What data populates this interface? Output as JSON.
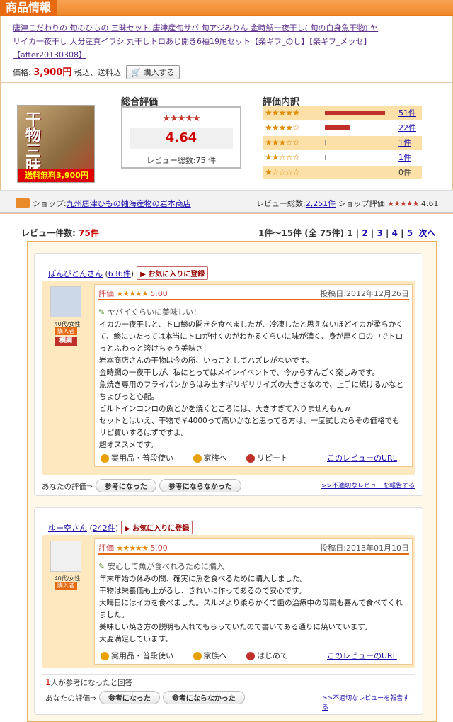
{
  "header": {
    "title": "商品情報"
  },
  "product": {
    "title": "唐津こだわりの 旬のひもの 三昧セット 唐津産旬サバ 旬アジみりん 金時鯛一夜干し( 旬の白身魚干物) ヤリイカ一夜干し 大分産真イワシ 丸干しトロあじ開き6種19尾セット【楽ギフ_のし】【楽ギフ_メッセ】【after20130308】",
    "price_label": "価格:",
    "price": "3,900円",
    "price_note": "税込、送料込",
    "buy_label": "購入する",
    "thumb_text": "干物三昧",
    "thumb_sub": "送料無料3,900円"
  },
  "overall": {
    "title": "総合評価",
    "stars": "★★★★★",
    "score": "4.64",
    "count_text": "レビュー総数:75 件"
  },
  "breakdown": {
    "title": "評価内訳",
    "rows": [
      {
        "stars": "★★★★★",
        "count": "51件",
        "fraction": 0.68,
        "link": true
      },
      {
        "stars": "★★★★☆",
        "count": "22件",
        "fraction": 0.29,
        "link": true
      },
      {
        "stars": "★★★☆☆",
        "count": "1件",
        "fraction": 0.013,
        "link": true
      },
      {
        "stars": "★★☆☆☆",
        "count": "1件",
        "fraction": 0.013,
        "link": true
      },
      {
        "stars": "★☆☆☆☆",
        "count": "0件",
        "fraction": 0,
        "link": false
      }
    ]
  },
  "shop": {
    "label": "ショップ:",
    "name": "九州唐津ひもの軸海産物の岩本商店",
    "review_label": "レビュー総数:",
    "review_count": "2,251件",
    "rating_label": "ショップ評価",
    "stars": "★★★★★",
    "rating": "4.61"
  },
  "list": {
    "count_label": "レビュー件数:",
    "count": "75件",
    "range": "1件〜15件 (全 75件)",
    "pages": [
      "1",
      "2",
      "3",
      "4",
      "5"
    ],
    "next": "次へ>>"
  },
  "reviews": [
    {
      "user": "ぽんぴとんさん",
      "posts": "636件",
      "fav": "▶ お気に入りに登録",
      "age": "40代/女性",
      "badge": "購入者",
      "badge2": "横綱",
      "rating_label": "評価",
      "stars": "★★★★★",
      "score": "5.00",
      "date": "投稿日:2012年12月26日",
      "title": "ヤバイくらいに美味しい！",
      "body": "イカの一夜干しと、トロ鯵の開きを食べましたが、冷凍したと思えないほどイカが柔らかくて、鯵にいたっては本当にトロが付くのがわかるくらいに味が濃く、身が厚く口の中でトロっとふわっと溶けちゃう美味さ！\n岩本商店さんの干物は今の所、いっことしてハズレがないです。\n金時鯛の一夜干しが、私にとってはメインイベントで、今からすんごく楽しみです。\n魚焼き専用のフライパンからはみ出すギリギリサイズの大きさなので、上手に焼けるかなとちょびっと心配。\nビルトインコンロの魚とかを焼くところには、大きすぎて入りませんもんw\nセットとはいえ、干物で￥4000って高いかなと思ってる方は、一度試したらその価格でもリピ買いするはずですよ。\n超オススメです。",
      "tags": [
        "実用品・普段使い",
        "家族へ",
        "リピート"
      ],
      "url_label": "このレビューのURL",
      "helpful": "",
      "your_rating": "あなたの評価⇒",
      "yes": "参考になった",
      "no": "参考にならなかった",
      "report": ">>不適切なレビューを報告する"
    },
    {
      "user": "ゆー空さん",
      "posts": "242件",
      "fav": "▶ お気に入りに登録",
      "age": "40代/女性",
      "badge": "購入者",
      "badge2": "",
      "rating_label": "評価",
      "stars": "★★★★★",
      "score": "5.00",
      "date": "投稿日:2013年01月10日",
      "title": "安心して魚が食べれるために購入",
      "body": "年末年始の休みの間、確実に魚を食べるために購入しました。\n干物は栄養価も上がるし、きれいに作ってあるので安心です。\n大晦日にはイカを食べました。スルメより柔らかくて歯の治療中の母親も喜んで食べてくれました。\n美味しい焼き方の説明も入れてもらっていたので書いてある通りに焼いています。\n大変満足しています。",
      "tags": [
        "実用品・普段使い",
        "家族へ",
        "はじめて"
      ],
      "url_label": "このレビューのURL",
      "helpful_num": "1",
      "helpful": "人が参考になったと回答",
      "your_rating": "あなたの評価⇒",
      "yes": "参考になった",
      "no": "参考にならなかった",
      "report": ">>不適切なレビューを報告する"
    }
  ]
}
